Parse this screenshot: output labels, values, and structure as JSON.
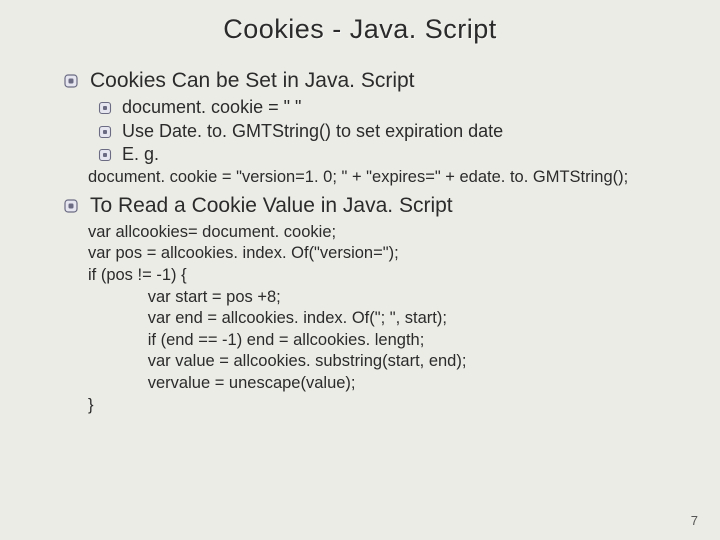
{
  "title": "Cookies - Java. Script",
  "section1": {
    "heading": "Cookies Can be Set in Java. Script",
    "items": [
      "document. cookie = \"   \"",
      "Use Date. to. GMTString() to set expiration date",
      "E. g."
    ],
    "code": "document. cookie = \"version=1. 0; \" + \"expires=\" + edate. to. GMTString();"
  },
  "section2": {
    "heading": "To Read a Cookie Value in Java. Script",
    "code": [
      "var allcookies= document. cookie;",
      "var pos = allcookies. index. Of(\"version=\");",
      "if (pos != -1) {",
      "   var start = pos +8;",
      "   var end = allcookies. index. Of(\"; \", start);",
      "   if (end == -1) end = allcookies. length;",
      "   var value = allcookies. substring(start, end);",
      "   vervalue = unescape(value);",
      "}"
    ]
  },
  "page_number": "7",
  "colors": {
    "bullet_outer": "#6b6b83",
    "bullet_inner": "#e6e6f0"
  }
}
